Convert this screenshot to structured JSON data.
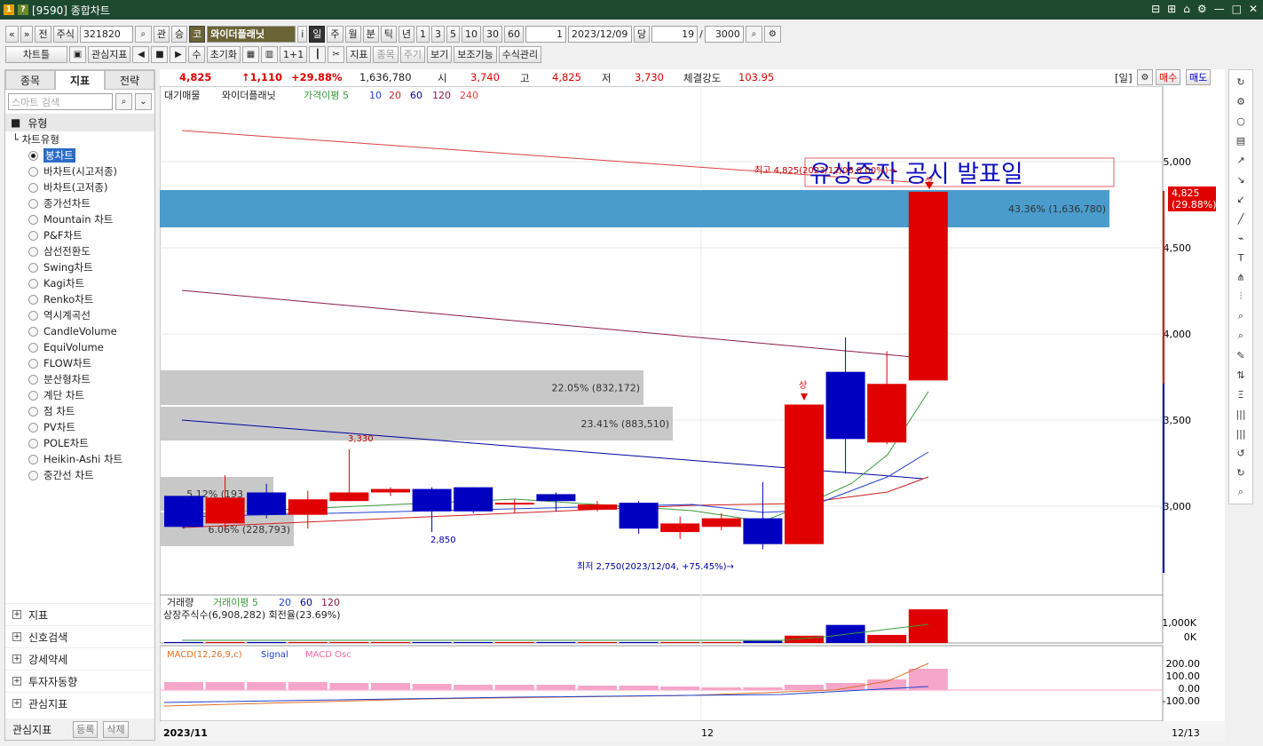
{
  "window": {
    "title": "[9590] 종합차트",
    "badge1": "1",
    "badge2": "?",
    "ctrls": [
      "⊟",
      "⊞",
      "⌂",
      "⚙",
      "—",
      "□",
      "✕"
    ]
  },
  "toolbar1": {
    "nav": [
      "«",
      "»"
    ],
    "prev": "전",
    "market": "주식",
    "code": "321820",
    "btns": [
      "관",
      "승"
    ],
    "kosdaq": "코",
    "name": "와이더플래닛",
    "info": "i",
    "periods": [
      "일",
      "주",
      "월",
      "분",
      "틱",
      "년"
    ],
    "nums": [
      "1",
      "3",
      "5",
      "10",
      "30",
      "60"
    ],
    "step": "1",
    "date": "2023/12/09",
    "dang": "당",
    "count": "19",
    "slash": "/",
    "total": "3000"
  },
  "toolbar2": {
    "chart_btn": "차트틀",
    "fav": "관심지표",
    "su": "수",
    "reset": "초기화",
    "oneone": "1+1",
    "ind": "지표",
    "item": "종목",
    "period": "주기",
    "view": "보기",
    "aux": "보조기능",
    "formula": "수식관리"
  },
  "left": {
    "tabs": [
      "종목",
      "지표",
      "전략"
    ],
    "search_placeholder": "스마트 검색",
    "group": "유형",
    "tree_root": "차트유형",
    "items": [
      "봉차트",
      "바차트(시고저종)",
      "바차트(고저종)",
      "종가선차트",
      "Mountain 차트",
      "P&F차트",
      "삼선전환도",
      "Swing차트",
      "Kagi차트",
      "Renko차트",
      "역시계곡선",
      "CandleVolume",
      "EquiVolume",
      "FLOW차트",
      "분산형차트",
      "계단 차트",
      "점 차트",
      "PV차트",
      "POLE차트",
      "Heikin-Ashi 차트",
      "중간선 차트"
    ],
    "folds": [
      "지표",
      "신호검색",
      "강세약세",
      "투자자동향",
      "관심지표"
    ],
    "bottom": {
      "label": "관심지표",
      "reg": "등록",
      "del": "삭제"
    }
  },
  "quote": {
    "price": "4,825",
    "change": "↑1,110",
    "rate": "+29.88%",
    "volume": "1,636,780",
    "open_l": "시",
    "open": "3,740",
    "high_l": "고",
    "high": "4,825",
    "low_l": "저",
    "low": "3,730",
    "str_l": "체결강도",
    "str": "103.95",
    "unit": "[일]",
    "buy": "매수",
    "sell": "매도"
  },
  "legend": {
    "items": [
      "대기매물",
      "와이더플래닛",
      "가격이평 5",
      "10",
      "20",
      "60",
      "120",
      "240"
    ]
  },
  "vol_legend": {
    "items": [
      "거래량",
      "거래이평 5",
      "20",
      "60",
      "120"
    ],
    "info": "상장주식수(6,908,282) 회전율(23.69%)"
  },
  "macd_legend": {
    "items": [
      "MACD(12,26,9,c)",
      "Signal",
      "MACD Osc"
    ]
  },
  "annot": {
    "title": "유상증자 공시 발표일",
    "high": "최고 4,825(2023/12/08,0.00%)→",
    "low": "최저 2,750(2023/12/04, +75.45%)→",
    "h3330": "3,330",
    "l2850": "2,850",
    "sang1": "상",
    "sang2": "상",
    "pct1": "43.36% (1,636,780)",
    "pct2": "22.05% (832,172)",
    "pct3": "23.41% (883,510)",
    "pct4": "5.12% (193",
    "pct5": "6.06% (228,793)",
    "last": "4,825",
    "last_rate": "(29.88%)",
    "x1": "2023/11",
    "x2": "12",
    "x3": "12/13"
  },
  "axes": {
    "price": [
      "5,000",
      "4,500",
      "4,000",
      "3,500",
      "3,000"
    ],
    "vol": [
      "1,000K",
      "0K"
    ],
    "macd": [
      "200.00",
      "100.00",
      "0.00",
      "-100.00"
    ]
  },
  "colors": {
    "up": "#e00000",
    "down": "#0000c0",
    "ma5": "#3a9a3a",
    "ma10": "#2040d0",
    "ma20": "#d02020",
    "ma60": "#0000a0",
    "ma120": "#8a1a4a"
  },
  "chart_data": {
    "type": "candlestick",
    "candles": [
      {
        "o": 3060,
        "h": 3000,
        "l": 2870,
        "c": 2880
      },
      {
        "o": 2900,
        "h": 3180,
        "l": 2870,
        "c": 3050
      },
      {
        "o": 3080,
        "h": 3130,
        "l": 2930,
        "c": 2950
      },
      {
        "o": 2950,
        "h": 3090,
        "l": 2870,
        "c": 3040
      },
      {
        "o": 3030,
        "h": 3330,
        "l": 3030,
        "c": 3080
      },
      {
        "o": 3080,
        "h": 3110,
        "l": 3060,
        "c": 3100
      },
      {
        "o": 3100,
        "h": 3110,
        "l": 2850,
        "c": 2970
      },
      {
        "o": 3110,
        "h": 3110,
        "l": 2960,
        "c": 2970
      },
      {
        "o": 3010,
        "h": 3040,
        "l": 2960,
        "c": 3020
      },
      {
        "o": 3070,
        "h": 3080,
        "l": 2970,
        "c": 3030
      },
      {
        "o": 2980,
        "h": 3030,
        "l": 2970,
        "c": 3010
      },
      {
        "o": 3020,
        "h": 3030,
        "l": 2840,
        "c": 2870
      },
      {
        "o": 2850,
        "h": 2940,
        "l": 2810,
        "c": 2900
      },
      {
        "o": 2880,
        "h": 2960,
        "l": 2860,
        "c": 2930
      },
      {
        "o": 2930,
        "h": 3140,
        "l": 2750,
        "c": 2780
      },
      {
        "o": 2780,
        "h": 3590,
        "l": 2780,
        "c": 3590
      },
      {
        "o": 3780,
        "h": 3980,
        "l": 3190,
        "c": 3390
      },
      {
        "o": 3370,
        "h": 3900,
        "l": 3360,
        "c": 3710
      },
      {
        "o": 3730,
        "h": 4825,
        "l": 3730,
        "c": 4825
      }
    ],
    "volumes": [
      2,
      2,
      2,
      2,
      2,
      2,
      2,
      2,
      2,
      2,
      2,
      2,
      2,
      2,
      30,
      160,
      430,
      180,
      820
    ]
  }
}
